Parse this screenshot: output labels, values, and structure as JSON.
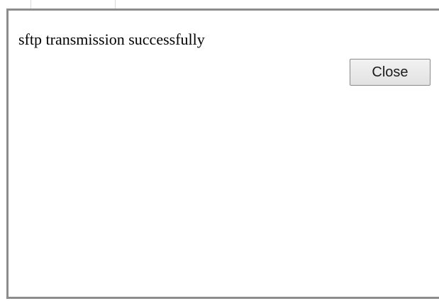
{
  "dialog": {
    "message": "sftp transmission successfully",
    "close_label": "Close"
  }
}
